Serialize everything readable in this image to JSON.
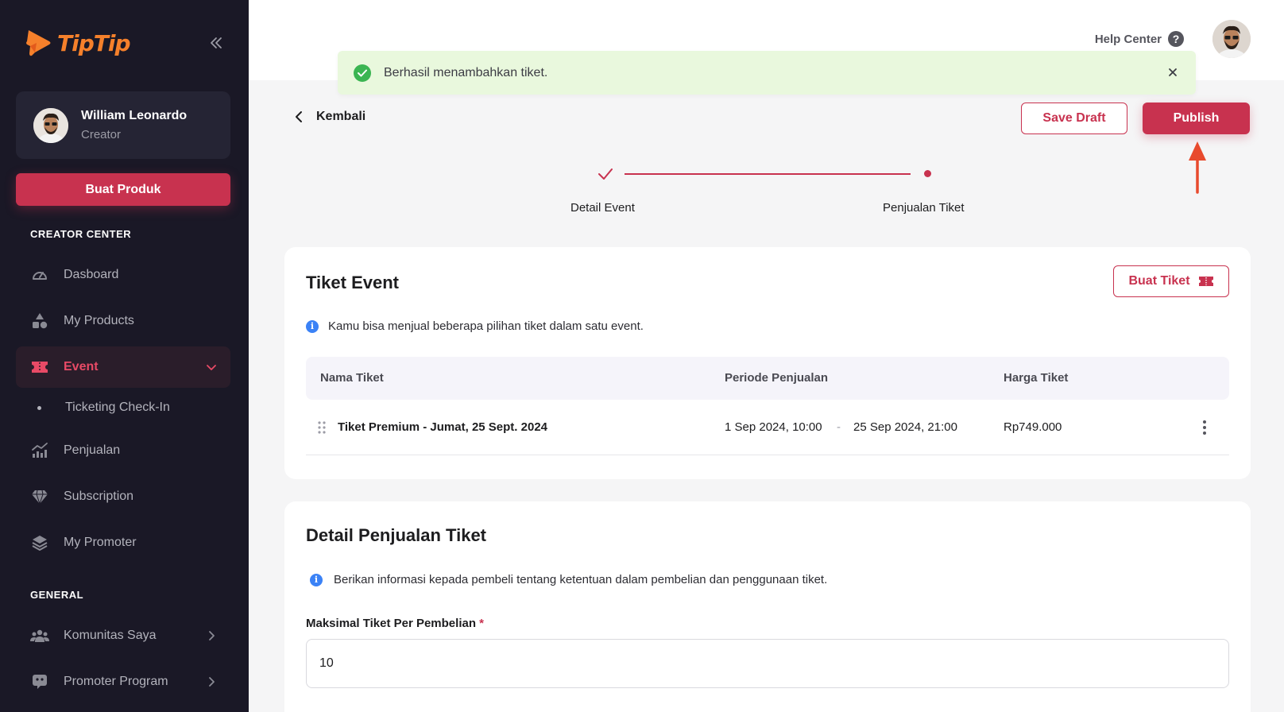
{
  "sidebar": {
    "logo_text": "TipTip",
    "profile": {
      "name": "William Leonardo",
      "role": "Creator"
    },
    "create_button": "Buat Produk",
    "sections": {
      "creator_center": "CREATOR CENTER",
      "general": "GENERAL"
    },
    "items": {
      "dashboard": "Dasboard",
      "my_products": "My Products",
      "event": "Event",
      "ticketing_checkin": "Ticketing Check-In",
      "penjualan": "Penjualan",
      "subscription": "Subscription",
      "my_promoter": "My Promoter",
      "komunitas": "Komunitas Saya",
      "promoter_program": "Promoter Program"
    }
  },
  "topbar": {
    "help_label": "Help Center"
  },
  "toast": {
    "message": "Berhasil menambahkan tiket."
  },
  "header": {
    "back_label": "Kembali",
    "save_draft": "Save Draft",
    "publish": "Publish"
  },
  "stepper": {
    "step1": "Detail Event",
    "step2": "Penjualan Tiket"
  },
  "ticket_card": {
    "title": "Tiket Event",
    "create_button": "Buat Tiket",
    "info": "Kamu bisa menjual beberapa pilihan tiket dalam satu event.",
    "columns": {
      "name": "Nama Tiket",
      "period": "Periode Penjualan",
      "price": "Harga Tiket"
    },
    "rows": [
      {
        "name": "Tiket Premium - Jumat, 25 Sept. 2024",
        "start": "1 Sep 2024, 10:00",
        "sep": "-",
        "end": "25 Sep 2024, 21:00",
        "price": "Rp749.000"
      }
    ]
  },
  "sales_card": {
    "title": "Detail Penjualan Tiket",
    "info": "Berikan informasi kepada pembeli tentang ketentuan dalam pembelian dan penggunaan tiket.",
    "max_label": "Maksimal Tiket Per Pembelian",
    "required_mark": "*",
    "max_value": "10"
  },
  "colors": {
    "brand": "#c8324f",
    "sidebar_bg": "#1a1826",
    "toast_bg": "#e9f8dd",
    "success": "#3bb552",
    "info": "#3b82f6",
    "logo": "#f5802b"
  }
}
